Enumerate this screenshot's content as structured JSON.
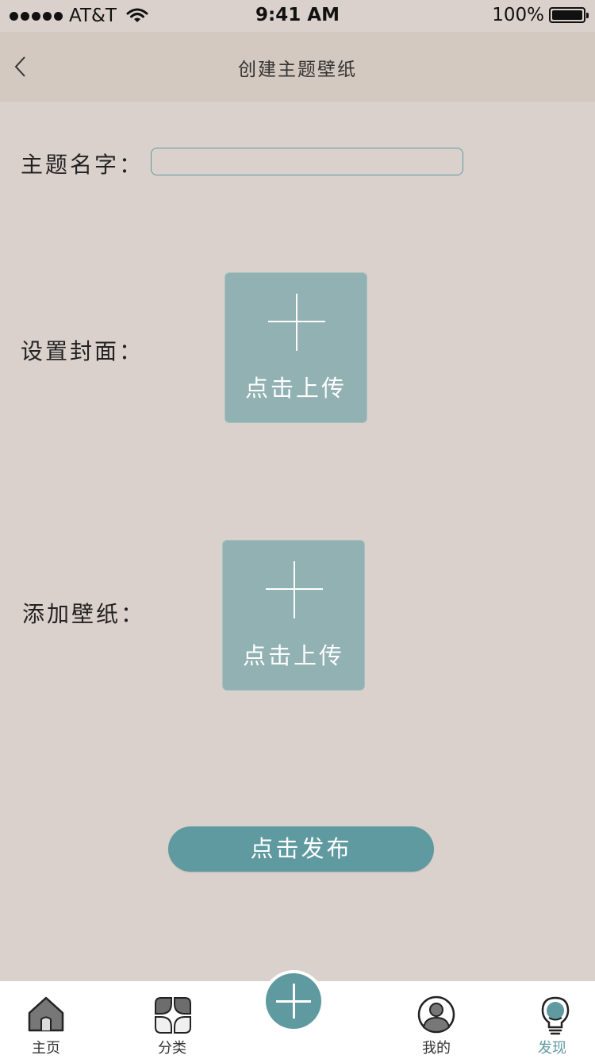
{
  "status_bar": {
    "carrier": "AT&T",
    "time": "9:41 AM",
    "battery": "100%",
    "battery_level": 1.0
  },
  "nav": {
    "title": "创建主题壁纸",
    "back_icon": "chevron-left-icon"
  },
  "form": {
    "name_label": "主题名字：",
    "name_value": "",
    "cover_label": "设置封面：",
    "cover_upload_label": "点击上传",
    "wallpaper_label": "添加壁纸：",
    "wallpaper_upload_label": "点击上传",
    "publish_label": "点击发布"
  },
  "tab_bar": {
    "items": [
      {
        "label": "主页",
        "icon": "home-icon"
      },
      {
        "label": "分类",
        "icon": "category-icon"
      },
      {
        "label": "",
        "icon": "plus-icon"
      },
      {
        "label": "我的",
        "icon": "profile-icon"
      },
      {
        "label": "发现",
        "icon": "lightbulb-icon"
      }
    ],
    "active_index": 4
  },
  "colors": {
    "background": "#dbd1cc",
    "nav_background": "#d4c9c0",
    "accent": "#5f9aa0",
    "upload_box": "#91b1b2"
  }
}
